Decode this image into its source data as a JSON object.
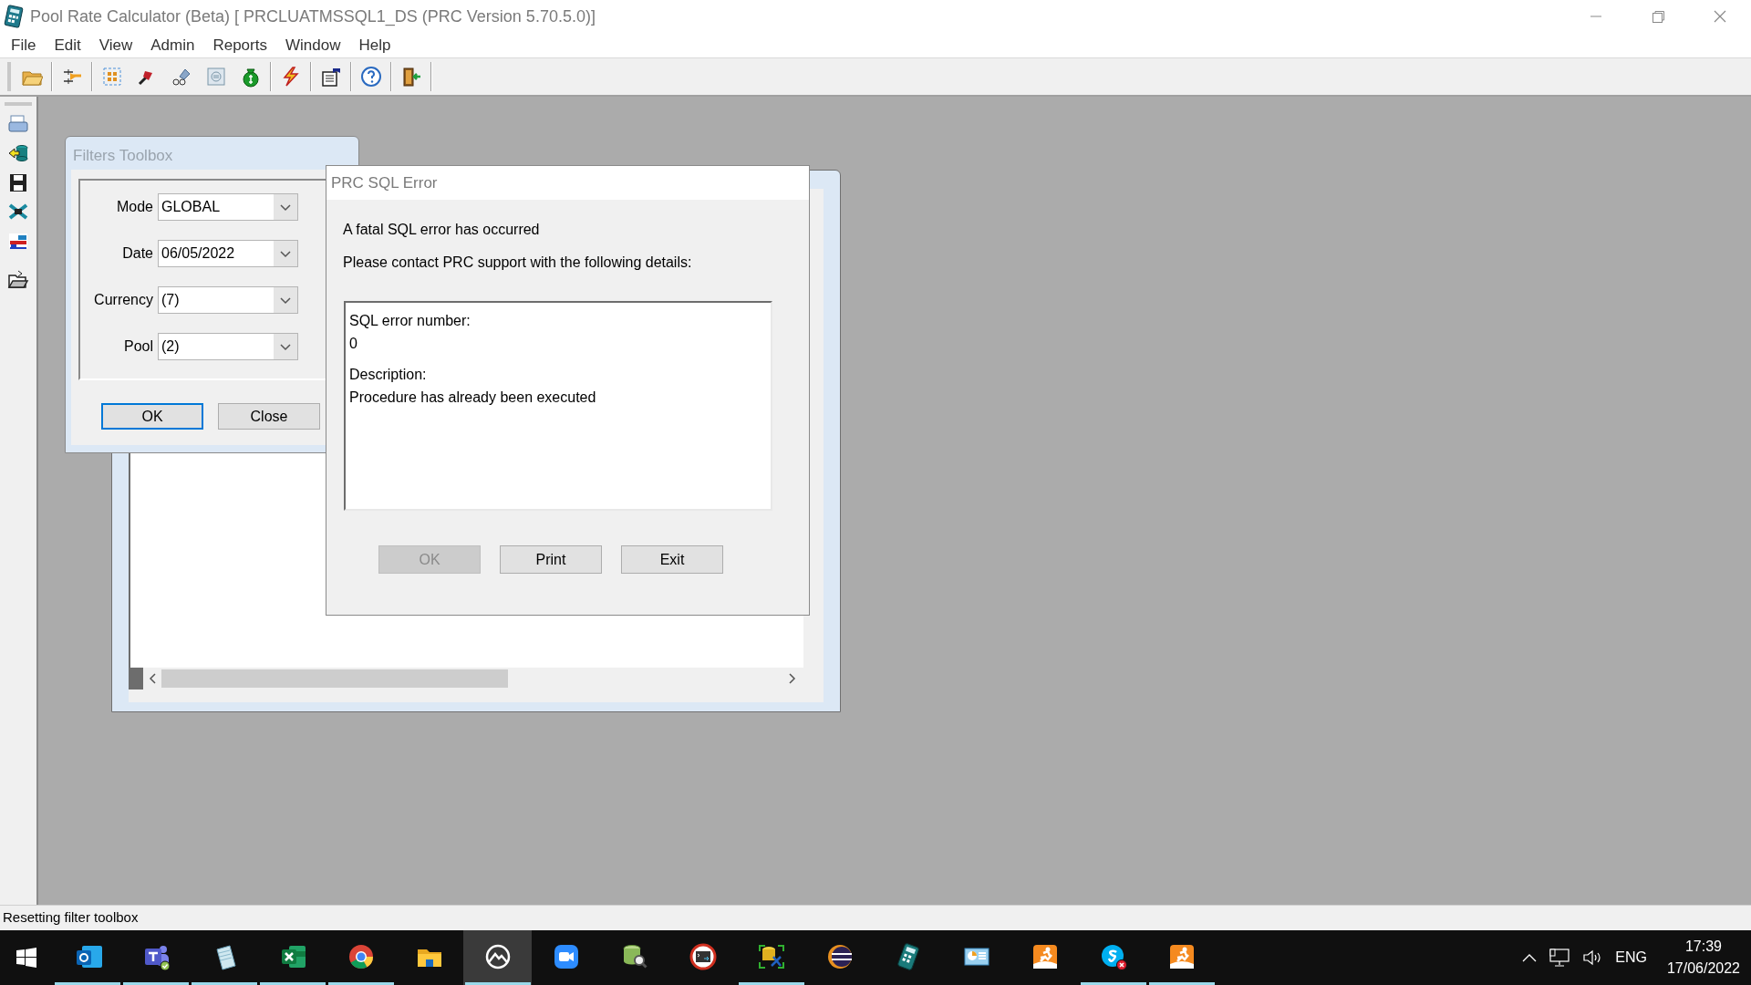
{
  "window": {
    "title": "Pool Rate Calculator (Beta) [ PRCLUATMSSQL1_DS (PRC Version 5.70.5.0)]"
  },
  "menu": [
    "File",
    "Edit",
    "View",
    "Admin",
    "Reports",
    "Window",
    "Help"
  ],
  "filters_toolbox": {
    "title": "Filters Toolbox",
    "fields": [
      {
        "label": "Mode",
        "value": "GLOBAL"
      },
      {
        "label": "Date",
        "value": "06/05/2022"
      },
      {
        "label": "Currency",
        "value": "(7)"
      },
      {
        "label": "Pool",
        "value": "(2)"
      }
    ],
    "buttons": [
      {
        "label": "OK",
        "focused": true
      },
      {
        "label": "Close",
        "focused": false
      }
    ]
  },
  "error_dialog": {
    "title": "PRC SQL Error",
    "messages": [
      "A fatal SQL error has occurred",
      "Please contact PRC support with the following details:"
    ],
    "details": [
      "SQL error number:",
      "0",
      "Description:",
      "Procedure has already been executed"
    ],
    "buttons": [
      {
        "label": "OK",
        "disabled": true
      },
      {
        "label": "Print",
        "disabled": false
      },
      {
        "label": "Exit",
        "disabled": false
      }
    ]
  },
  "status_bar": "Resetting filter toolbox",
  "taskbar": {
    "apps": [
      {
        "running": true,
        "active": false
      },
      {
        "running": true,
        "active": false
      },
      {
        "running": true,
        "active": false
      },
      {
        "running": true,
        "active": false
      },
      {
        "running": true,
        "active": false
      },
      {
        "running": false,
        "active": false
      },
      {
        "running": true,
        "active": true
      },
      {
        "running": false,
        "active": false
      },
      {
        "running": false,
        "active": false
      },
      {
        "running": false,
        "active": false
      },
      {
        "running": true,
        "active": false
      },
      {
        "running": false,
        "active": false
      },
      {
        "running": false,
        "active": false
      },
      {
        "running": false,
        "active": false
      },
      {
        "running": false,
        "active": false
      },
      {
        "running": true,
        "active": false
      },
      {
        "running": true,
        "active": false
      }
    ],
    "language": "ENG",
    "time": "17:39",
    "date": "17/06/2022"
  }
}
